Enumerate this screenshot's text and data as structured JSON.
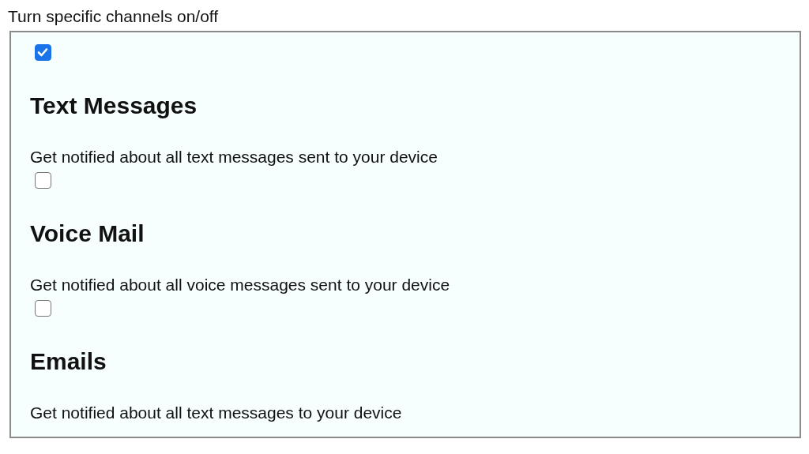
{
  "title": "Turn specific channels on/off",
  "channels": [
    {
      "name": "Text Messages",
      "description": "Get notified about all text messages sent to your device",
      "checked": true
    },
    {
      "name": "Voice Mail",
      "description": "Get notified about all voice messages sent to your device",
      "checked": false
    },
    {
      "name": "Emails",
      "description": "Get notified about all text messages to your device",
      "checked": false
    }
  ]
}
